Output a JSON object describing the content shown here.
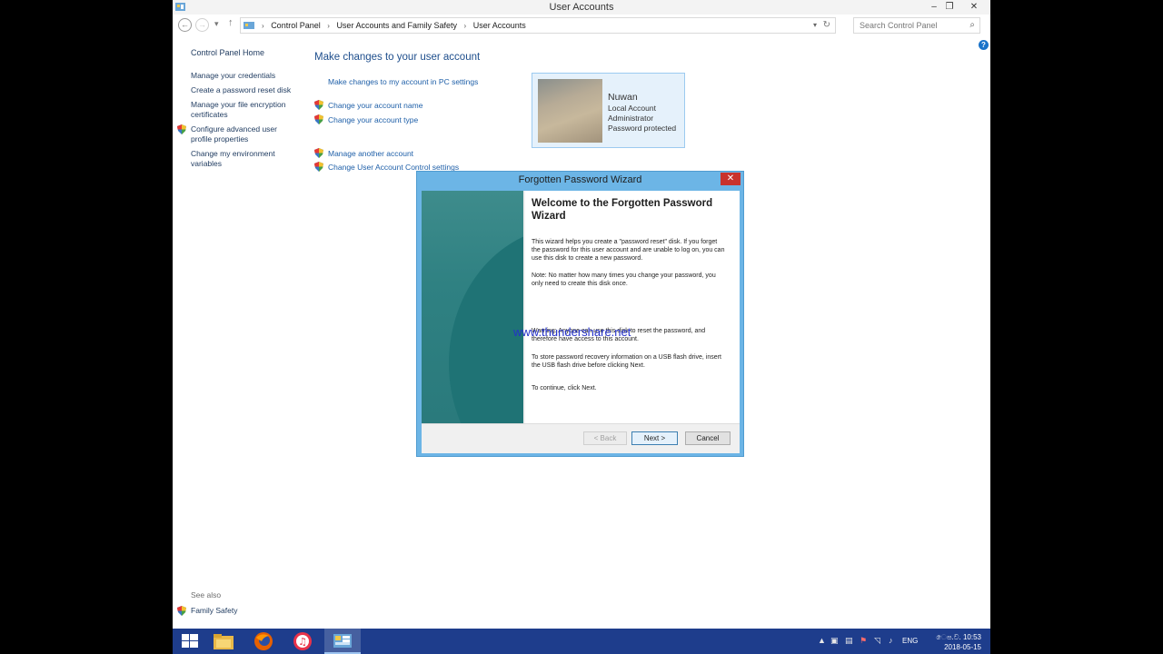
{
  "window": {
    "title": "User Accounts",
    "controls": {
      "minimize": "–",
      "restore": "❐",
      "close": "✕"
    }
  },
  "addressbar": {
    "breadcrumbs": [
      "Control Panel",
      "User Accounts and Family Safety",
      "User Accounts"
    ],
    "search_placeholder": "Search Control Panel"
  },
  "leftnav": {
    "home": "Control Panel Home",
    "items": [
      "Manage your credentials",
      "Create a password reset disk",
      "Manage your file encryption certificates",
      "Configure advanced user profile properties",
      "Change my environment variables"
    ],
    "see_also_heading": "See also",
    "see_also_items": [
      "Family Safety"
    ]
  },
  "main": {
    "title": "Make changes to your user account",
    "pc_settings_link": "Make changes to my account in PC settings",
    "links": [
      "Change your account name",
      "Change your account type",
      "Manage another account",
      "Change User Account Control settings"
    ]
  },
  "user_card": {
    "name": "Nuwan",
    "lines": [
      "Local Account",
      "Administrator",
      "Password protected"
    ]
  },
  "dialog": {
    "title": "Forgotten Password Wizard",
    "close": "✕",
    "heading": "Welcome to the Forgotten Password Wizard",
    "paragraphs": [
      "This wizard helps you create a \"password reset\" disk. If you forget the password for this user account and are unable to log on, you can use this disk to create a new password.",
      "Note: No matter how many times you change your password, you only need to create this disk once.",
      "Warning: Anyone can use this disk to reset the password, and therefore have access to this account.",
      "To store password recovery information on a USB flash drive, insert the USB flash drive before clicking Next.",
      "To continue, click Next."
    ],
    "buttons": {
      "back": "< Back",
      "next": "Next >",
      "cancel": "Cancel"
    }
  },
  "watermark": "www.thundershare.net",
  "taskbar": {
    "apps": [
      "start",
      "file-explorer",
      "firefox",
      "itunes",
      "control-panel"
    ],
    "language": "ENG",
    "time": "ෙප.ව. 10:53",
    "date": "2018-05-15"
  },
  "colors": {
    "link": "#1e5fa8",
    "taskbar": "#1e3d8c",
    "dialog_frame": "#6cb5e6",
    "user_card_bg": "#e5f1fb"
  }
}
